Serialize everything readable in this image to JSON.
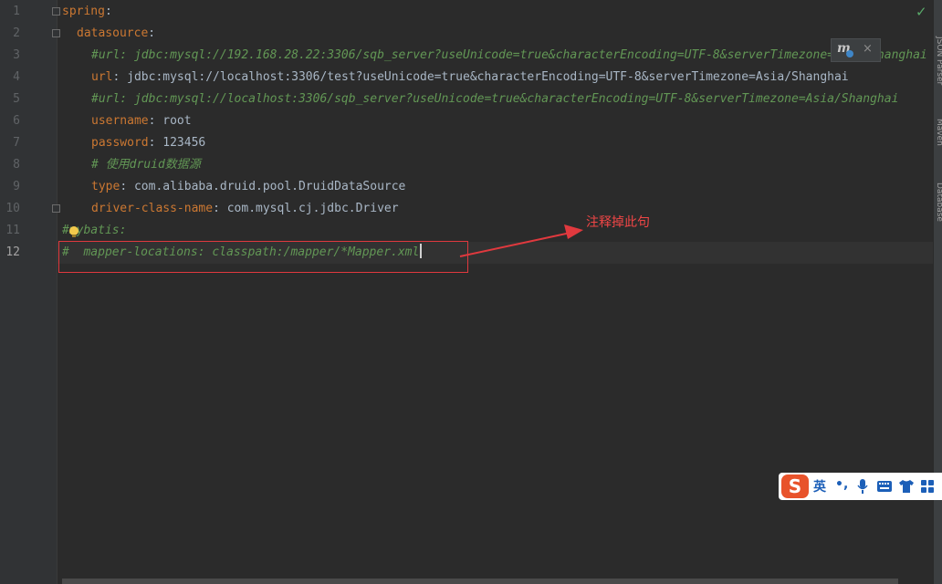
{
  "editor": {
    "line_numbers": [
      "1",
      "2",
      "3",
      "4",
      "5",
      "6",
      "7",
      "8",
      "9",
      "10",
      "11",
      "12"
    ],
    "lines": [
      {
        "key": "spring",
        "sep": ":"
      },
      {
        "key": "datasource",
        "sep": ":"
      },
      {
        "comment": "#url: jdbc:mysql://192.168.28.22:3306/sqb_server?useUnicode=true&characterEncoding=UTF-8&serverTimezone=Asia/Shanghai"
      },
      {
        "key": "url",
        "sep": ": ",
        "value": "jdbc:mysql://localhost:3306/test?useUnicode=true&characterEncoding=UTF-8&serverTimezone=Asia/Shanghai"
      },
      {
        "comment": "#url: jdbc:mysql://localhost:3306/sqb_server?useUnicode=true&characterEncoding=UTF-8&serverTimezone=Asia/Shanghai"
      },
      {
        "key": "username",
        "sep": ": ",
        "value": "root"
      },
      {
        "key": "password",
        "sep": ": ",
        "value": "123456"
      },
      {
        "comment": "# 使用druid数据源"
      },
      {
        "key": "type",
        "sep": ": ",
        "value": "com.alibaba.druid.pool.DruidDataSource"
      },
      {
        "key": "driver-class-name",
        "sep": ": ",
        "value": "com.mysql.cj.jdbc.Driver"
      },
      {
        "comment": "#mybatis:"
      },
      {
        "comment": "#  mapper-locations: classpath:/mapper/*Mapper.xml"
      }
    ]
  },
  "annotation": {
    "text": "注释掉此句",
    "color": "#f04646"
  },
  "status": {
    "inspection": "✓",
    "inspection_color": "#59a869"
  },
  "mapper_popup": {
    "icon": "mybatis-mapper-icon",
    "close": "×"
  },
  "right_tabs": [
    "JSON Parser",
    "Maven",
    "Database"
  ],
  "ime_toolbar": {
    "logo": "S",
    "language": "英",
    "punct": "•,",
    "icons": [
      "mic-icon",
      "keyboard-icon",
      "skin-icon",
      "apps-icon"
    ]
  },
  "colors": {
    "background": "#2b2b2b",
    "keyword": "#cc7832",
    "comment": "#629755",
    "text": "#a9b7c6",
    "highlight_box": "#e0393e"
  }
}
